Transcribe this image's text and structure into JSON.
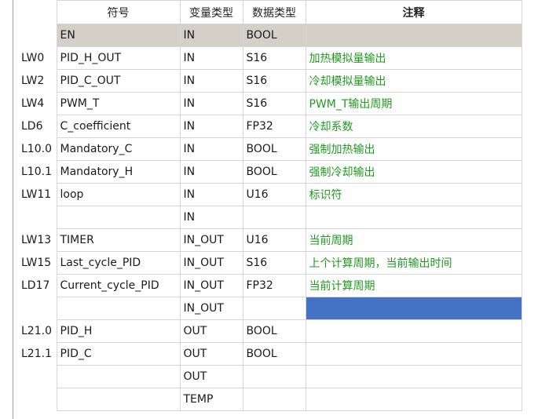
{
  "headers": {
    "symbol": "符号",
    "var_type": "变量类型",
    "data_type": "数据类型",
    "comment": "注释"
  },
  "rows": [
    {
      "addr": "",
      "symbol": "EN",
      "var_type": "IN",
      "data_type": "BOOL",
      "comment": ""
    },
    {
      "addr": "LW0",
      "symbol": "PID_H_OUT",
      "var_type": "IN",
      "data_type": "S16",
      "comment": "加热模拟量输出"
    },
    {
      "addr": "LW2",
      "symbol": "PID_C_OUT",
      "var_type": "IN",
      "data_type": "S16",
      "comment": "冷却模拟量输出"
    },
    {
      "addr": "LW4",
      "symbol": "PWM_T",
      "var_type": "IN",
      "data_type": "S16",
      "comment": "PWM_T输出周期"
    },
    {
      "addr": "LD6",
      "symbol": "C_coefficient",
      "var_type": "IN",
      "data_type": "FP32",
      "comment": "冷却系数"
    },
    {
      "addr": "L10.0",
      "symbol": "Mandatory_C",
      "var_type": "IN",
      "data_type": "BOOL",
      "comment": "强制加热输出"
    },
    {
      "addr": "L10.1",
      "symbol": "Mandatory_H",
      "var_type": "IN",
      "data_type": "BOOL",
      "comment": "强制冷却输出"
    },
    {
      "addr": "LW11",
      "symbol": "loop",
      "var_type": "IN",
      "data_type": "U16",
      "comment": "标识符"
    },
    {
      "addr": "",
      "symbol": "",
      "var_type": "IN",
      "data_type": "",
      "comment": ""
    },
    {
      "addr": "LW13",
      "symbol": "TIMER",
      "var_type": "IN_OUT",
      "data_type": "U16",
      "comment": "当前周期"
    },
    {
      "addr": "LW15",
      "symbol": "Last_cycle_PID",
      "var_type": "IN_OUT",
      "data_type": "S16",
      "comment": "上个计算周期，当前输出时间"
    },
    {
      "addr": "LD17",
      "symbol": "Current_cycle_PID",
      "var_type": "IN_OUT",
      "data_type": "FP32",
      "comment": "当前计算周期"
    },
    {
      "addr": "",
      "symbol": "",
      "var_type": "IN_OUT",
      "data_type": "",
      "comment": ""
    },
    {
      "addr": "L21.0",
      "symbol": "PID_H",
      "var_type": "OUT",
      "data_type": "BOOL",
      "comment": ""
    },
    {
      "addr": "L21.1",
      "symbol": "PID_C",
      "var_type": "OUT",
      "data_type": "BOOL",
      "comment": ""
    },
    {
      "addr": "",
      "symbol": "",
      "var_type": "OUT",
      "data_type": "",
      "comment": ""
    },
    {
      "addr": "",
      "symbol": "",
      "var_type": "TEMP",
      "data_type": "",
      "comment": ""
    }
  ],
  "colors": {
    "comment_text": "#1f9a1f",
    "en_row_bg": "#d4d0c8",
    "selection": "#4472c4"
  }
}
